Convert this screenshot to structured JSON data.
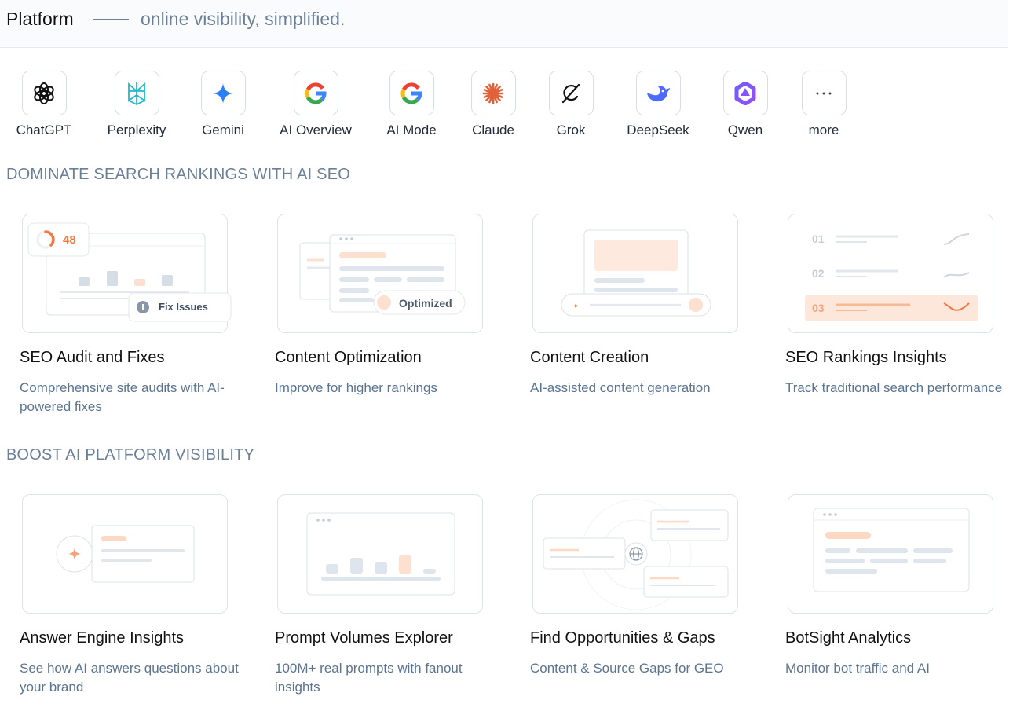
{
  "header": {
    "title": "Platform",
    "subtitle": "online visibility, simplified."
  },
  "platforms": [
    {
      "label": "ChatGPT",
      "icon": "chatgpt-icon"
    },
    {
      "label": "Perplexity",
      "icon": "perplexity-icon"
    },
    {
      "label": "Gemini",
      "icon": "gemini-icon"
    },
    {
      "label": "AI Overview",
      "icon": "google-icon"
    },
    {
      "label": "AI Mode",
      "icon": "google-icon"
    },
    {
      "label": "Claude",
      "icon": "claude-icon"
    },
    {
      "label": "Grok",
      "icon": "grok-icon"
    },
    {
      "label": "DeepSeek",
      "icon": "deepseek-icon"
    },
    {
      "label": "Qwen",
      "icon": "qwen-icon"
    },
    {
      "label": "more",
      "icon": "more-icon"
    }
  ],
  "sections": [
    {
      "title": "DOMINATE SEARCH RANKINGS WITH AI SEO",
      "cards": [
        {
          "title": "SEO Audit and Fixes",
          "desc": "Comprehensive site audits with AI-powered fixes"
        },
        {
          "title": "Content Optimization",
          "desc": "Improve for higher rankings"
        },
        {
          "title": "Content Creation",
          "desc": "AI-assisted content generation"
        },
        {
          "title": "SEO Rankings Insights",
          "desc": "Track traditional search performance"
        }
      ]
    },
    {
      "title": "BOOST AI PLATFORM VISIBILITY",
      "cards": [
        {
          "title": "Answer Engine Insights",
          "desc": "See how AI answers questions about your brand"
        },
        {
          "title": "Prompt Volumes Explorer",
          "desc": "100M+ real prompts with fanout insights"
        },
        {
          "title": "Find Opportunities & Gaps",
          "desc": "Content & Source Gaps for GEO"
        },
        {
          "title": "BotSight Analytics",
          "desc": "Monitor bot traffic and AI"
        }
      ]
    }
  ],
  "thumbs": {
    "audit_score": "48",
    "fix_issues": "Fix Issues",
    "optimized": "Optimized",
    "rank_1": "01",
    "rank_2": "02",
    "rank_3": "03"
  },
  "colors": {
    "accent": "#f07a45",
    "muted": "#6b7f96",
    "border": "#dde3ea"
  }
}
